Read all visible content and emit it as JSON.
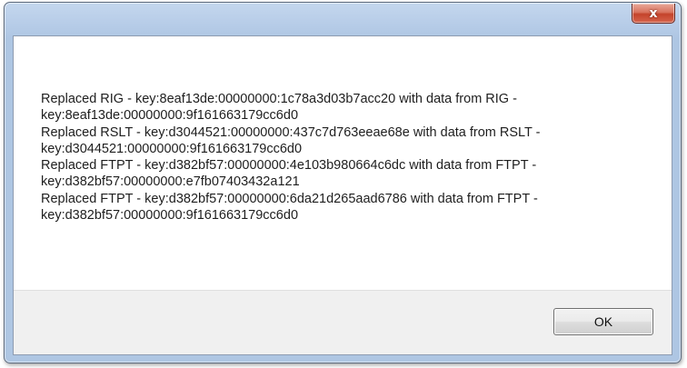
{
  "dialog": {
    "close_glyph": "x",
    "message_lines": [
      "Replaced RIG - key:8eaf13de:00000000:1c78a3d03b7acc20 with data from RIG -",
      "key:8eaf13de:00000000:9f161663179cc6d0",
      "Replaced RSLT - key:d3044521:00000000:437c7d763eeae68e with data from RSLT -",
      "key:d3044521:00000000:9f161663179cc6d0",
      "Replaced FTPT - key:d382bf57:00000000:4e103b980664c6dc with data from FTPT -",
      "key:d382bf57:00000000:e7fb07403432a121",
      "Replaced FTPT - key:d382bf57:00000000:6da21d265aad6786 with data from FTPT -",
      "key:d382bf57:00000000:9f161663179cc6d0"
    ],
    "ok_label": "OK"
  },
  "icons": {
    "close": "close-icon"
  },
  "colors": {
    "title_bar": "#b9cee9",
    "close_button": "#c4432b",
    "button_bar": "#f0f0f0"
  }
}
